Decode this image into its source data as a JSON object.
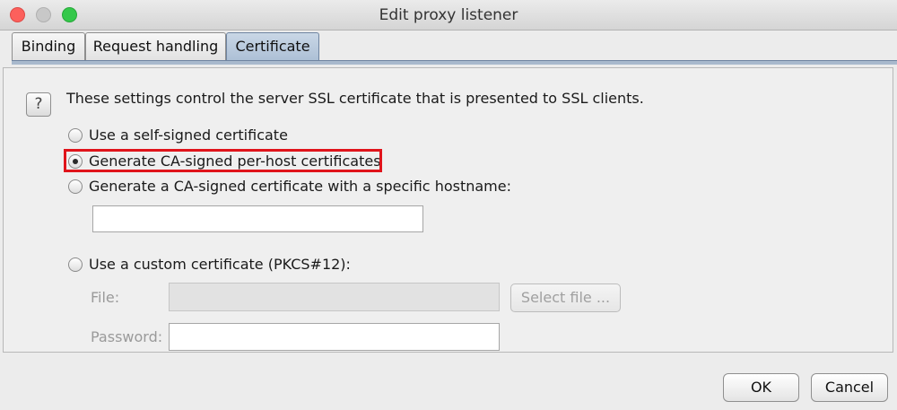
{
  "window": {
    "title": "Edit proxy listener"
  },
  "tabs": [
    {
      "label": "Binding",
      "active": false
    },
    {
      "label": "Request handling",
      "active": false
    },
    {
      "label": "Certificate",
      "active": true
    }
  ],
  "panel": {
    "help_icon_glyph": "?",
    "intro": "These settings control the server SSL certificate that is presented to SSL clients.",
    "options": [
      {
        "label": "Use a self-signed certificate",
        "selected": false
      },
      {
        "label": "Generate CA-signed per-host certificates",
        "selected": true
      },
      {
        "label": "Generate a CA-signed certificate with a specific hostname:",
        "selected": false
      },
      {
        "label": "Use a custom certificate (PKCS#12):",
        "selected": false
      }
    ],
    "hostname_value": "",
    "file_label": "File:",
    "file_value": "",
    "password_label": "Password:",
    "password_value": "",
    "select_file_label": "Select file ...",
    "highlight_color": "#e0141b"
  },
  "buttons": {
    "ok": "OK",
    "cancel": "Cancel"
  }
}
